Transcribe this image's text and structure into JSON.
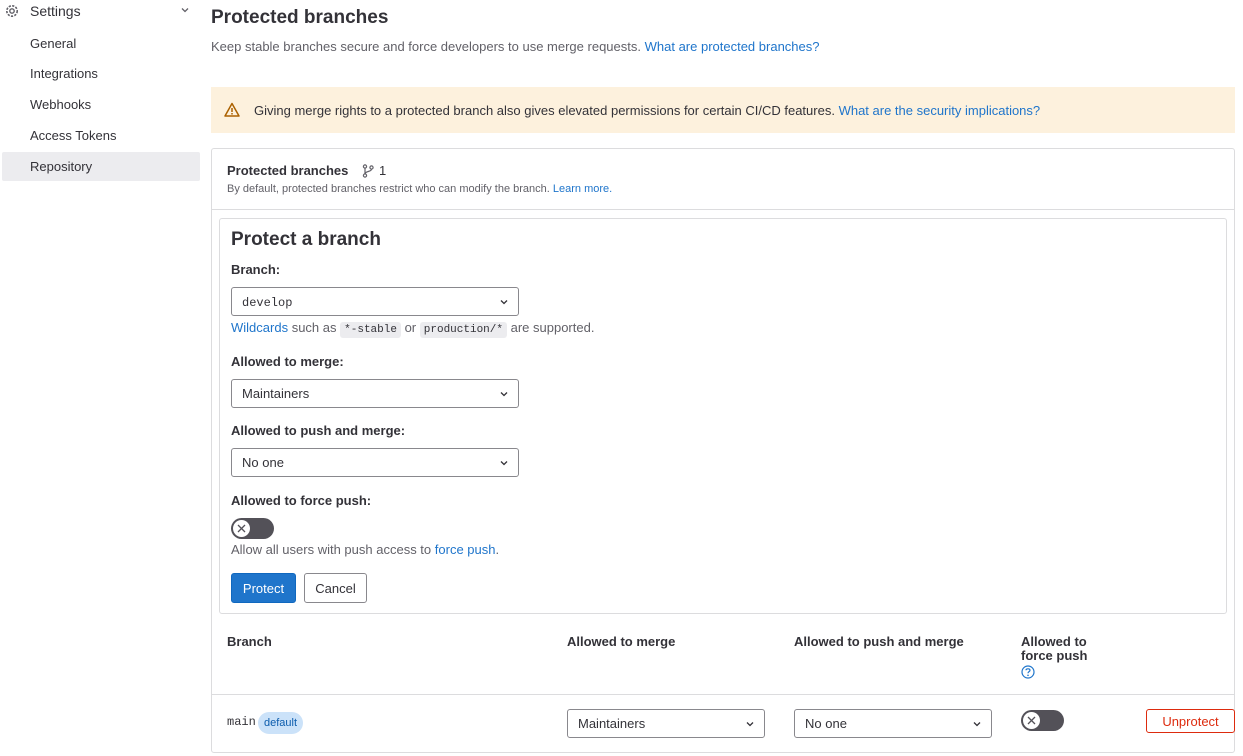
{
  "sidebar": {
    "title": "Settings",
    "items": [
      {
        "label": "General",
        "active": false
      },
      {
        "label": "Integrations",
        "active": false
      },
      {
        "label": "Webhooks",
        "active": false
      },
      {
        "label": "Access Tokens",
        "active": false
      },
      {
        "label": "Repository",
        "active": true
      }
    ]
  },
  "page": {
    "title": "Protected branches",
    "description": "Keep stable branches secure and force developers to use merge requests.",
    "description_link": "What are protected branches?"
  },
  "alert": {
    "text": "Giving merge rights to a protected branch also gives elevated permissions for certain CI/CD features.",
    "link": "What are the security implications?",
    "icon": "warning-icon"
  },
  "card": {
    "title": "Protected branches",
    "count": "1",
    "subtitle": "By default, protected branches restrict who can modify the branch.",
    "subtitle_link": "Learn more."
  },
  "form": {
    "title": "Protect a branch",
    "branch_label": "Branch:",
    "branch_value": "develop",
    "wildcard_link": "Wildcards",
    "wildcard_text1": "such as",
    "wildcard_code1": "*-stable",
    "wildcard_text2": "or",
    "wildcard_code2": "production/*",
    "wildcard_text3": "are supported.",
    "merge_label": "Allowed to merge:",
    "merge_value": "Maintainers",
    "push_label": "Allowed to push and merge:",
    "push_value": "No one",
    "force_label": "Allowed to force push:",
    "force_enabled": false,
    "force_help": "Allow all users with push access to",
    "force_help_link": "force push",
    "force_help_end": ".",
    "protect_button": "Protect",
    "cancel_button": "Cancel"
  },
  "table": {
    "headers": {
      "branch": "Branch",
      "merge": "Allowed to merge",
      "push": "Allowed to push and merge",
      "force_line1": "Allowed to",
      "force_line2": "force push"
    },
    "rows": [
      {
        "branch": "main",
        "badge": "default",
        "merge": "Maintainers",
        "push": "No one",
        "force_enabled": false,
        "action": "Unprotect"
      }
    ]
  },
  "colors": {
    "link": "#1f75cb",
    "primary": "#1f75cb",
    "danger": "#dd2b0e",
    "alert_bg": "#fdf1dd",
    "badge_bg": "#cbe2f9"
  }
}
